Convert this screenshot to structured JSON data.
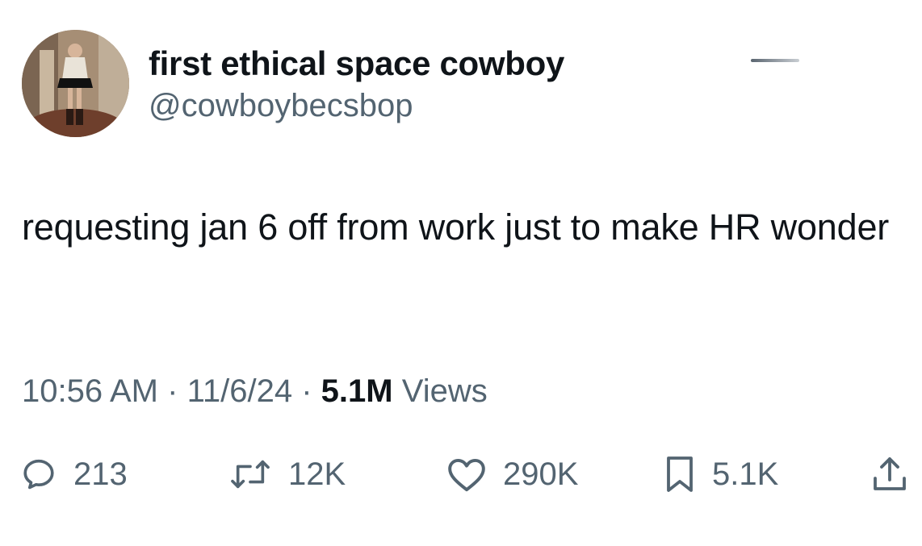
{
  "author": {
    "display_name": "first ethical space cowboy",
    "handle": "@cowboybecsbop",
    "avatar_icon": "profile-photo"
  },
  "tweet": {
    "text": "requesting jan 6 off from work just to make HR wonder",
    "time": "10:56 AM",
    "date": "11/6/24",
    "separator": "·",
    "views_count": "5.1M",
    "views_label": "Views"
  },
  "actions": {
    "reply": {
      "icon": "reply-icon",
      "count": "213"
    },
    "retweet": {
      "icon": "retweet-icon",
      "count": "12K"
    },
    "like": {
      "icon": "heart-icon",
      "count": "290K"
    },
    "bookmark": {
      "icon": "bookmark-icon",
      "count": "5.1K"
    },
    "share": {
      "icon": "share-icon"
    }
  },
  "colors": {
    "text_primary": "#0f1419",
    "text_secondary": "#536471",
    "background": "#ffffff"
  }
}
